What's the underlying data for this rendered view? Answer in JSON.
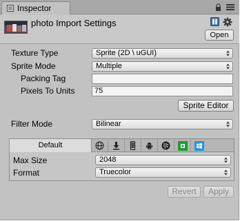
{
  "window": {
    "tab_title": "Inspector"
  },
  "header": {
    "title": "photo Import Settings",
    "open_label": "Open"
  },
  "settings": {
    "texture_type": {
      "label": "Texture Type",
      "value": "Sprite (2D \\ uGUI)"
    },
    "sprite_mode": {
      "label": "Sprite Mode",
      "value": "Multiple"
    },
    "packing_tag": {
      "label": "Packing Tag",
      "value": ""
    },
    "pixels_to_units": {
      "label": "Pixels To Units",
      "value": "75"
    },
    "sprite_editor_label": "Sprite Editor",
    "filter_mode": {
      "label": "Filter Mode",
      "value": "Bilinear"
    }
  },
  "platforms": {
    "default_tab": "Default",
    "tabs": [
      "globe-icon",
      "download-icon",
      "phone-icon",
      "android-icon",
      "blackberry-icon",
      "windows-store-icon",
      "windows-phone-icon"
    ],
    "max_size": {
      "label": "Max Size",
      "value": "2048"
    },
    "format": {
      "label": "Format",
      "value": "Truecolor"
    }
  },
  "footer": {
    "revert_label": "Revert",
    "apply_label": "Apply"
  },
  "colors": {
    "background": "#c2c2c2",
    "green_tile": "#1f9b2e",
    "blue_tile": "#1e9ad6"
  }
}
